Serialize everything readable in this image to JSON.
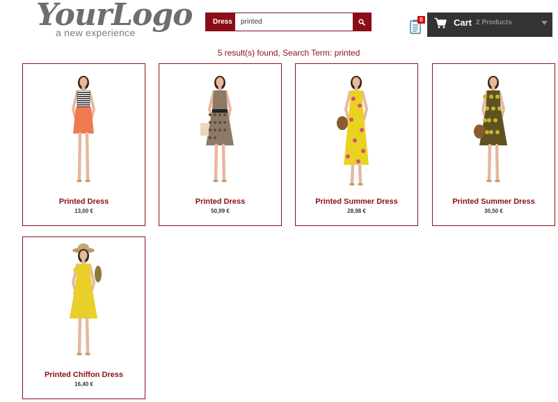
{
  "header": {
    "logo_main": "YourLogo",
    "logo_sub": "a new experience",
    "search": {
      "category_label": "Dress",
      "query": "printed",
      "placeholder": "",
      "button_icon": "search-icon"
    },
    "compare": {
      "badge_count": "0",
      "icon": "compare-list-icon"
    },
    "cart": {
      "label": "Cart",
      "count_text": "2 Products",
      "icon": "shopping-cart-icon",
      "caret_icon": "chevron-down-icon"
    }
  },
  "results_text": "5 result(s) found, Search Term: printed",
  "products": [
    {
      "name": "Printed Dress",
      "price": "13,00 €",
      "dress_color": "#f07a50",
      "top_color": "#222222",
      "pattern": "stripe-top"
    },
    {
      "name": "Printed Dress",
      "price": "50,99 €",
      "dress_color": "#8c7a66",
      "top_color": "#5c4d3e",
      "pattern": "leopard"
    },
    {
      "name": "Printed Summer Dress",
      "price": "28,98 €",
      "dress_color": "#e8d31f",
      "top_color": "#d94c83",
      "pattern": "floral-maxi"
    },
    {
      "name": "Printed Summer Dress",
      "price": "30,50 €",
      "dress_color": "#5e5320",
      "top_color": "#c8b432",
      "pattern": "floral-dark"
    },
    {
      "name": "Printed Chiffon Dress",
      "price": "16,40 €",
      "dress_color": "#e8cf2a",
      "top_color": "#e8cf2a",
      "pattern": "chiffon-hat"
    }
  ],
  "colors": {
    "accent": "#8b0d17",
    "cart_bg": "#333333",
    "badge": "#d40f0f"
  }
}
